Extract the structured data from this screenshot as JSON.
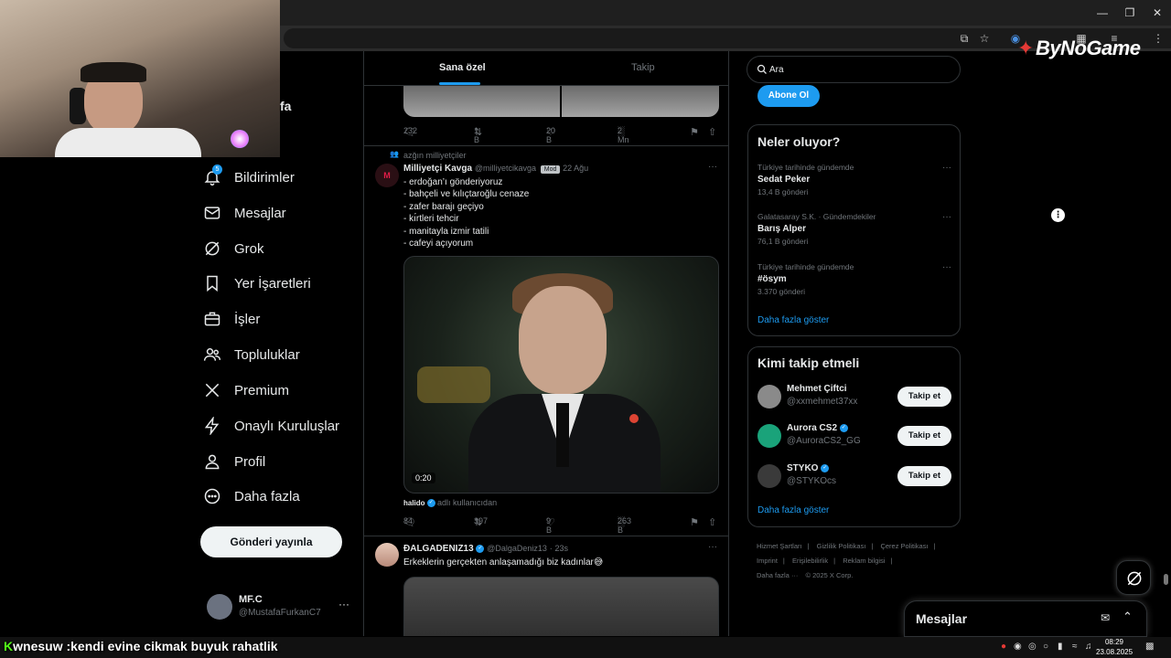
{
  "overlay": {
    "brand": "ByNoGame",
    "brand_mark": "✦",
    "ticker_prefix": "K",
    "ticker_text": "wnesuw :kendi evine cikmak buyuk rahatlik",
    "clock_time": "08:29",
    "clock_date": "23.08.2025"
  },
  "sidebar": {
    "name_fragment": "fa",
    "items": [
      {
        "label": "Bildirimler",
        "icon": "bell-icon"
      },
      {
        "label": "Mesajlar",
        "icon": "mail-icon"
      },
      {
        "label": "Grok",
        "icon": "grok-icon"
      },
      {
        "label": "Yer İşaretleri",
        "icon": "bookmark-icon"
      },
      {
        "label": "İşler",
        "icon": "briefcase-icon"
      },
      {
        "label": "Topluluklar",
        "icon": "people-icon"
      },
      {
        "label": "Premium",
        "icon": "x-logo-icon"
      },
      {
        "label": "Onaylı Kuruluşlar",
        "icon": "lightning-icon"
      },
      {
        "label": "Profil",
        "icon": "person-icon"
      },
      {
        "label": "Daha fazla",
        "icon": "more-circle-icon"
      }
    ],
    "notification_badge": "5",
    "post_button": "Gönderi yayınla",
    "account": {
      "name": "MF.C",
      "handle": "@MustafaFurkanC7",
      "more": "···"
    }
  },
  "feed": {
    "tabs": [
      "Sana özel",
      "Takip"
    ],
    "tweet0": {
      "replies": "232",
      "retweets": "1 B",
      "likes": "20 B",
      "views": "2 Mn"
    },
    "tweet1": {
      "community": "azğın milliyetçiler",
      "name": "Milliyetçi Kavga",
      "handle": "@milliyetcikavga",
      "badge": "Mod",
      "date": "22 Ağu",
      "lines": [
        "- erdoğan’ı gönderiyoruz",
        "- bahçeli ve kılıçtaroğlu cenaze",
        "- zafer barajı geçiyo",
        "- kı́rtleri tehcir",
        "- manitayla izmir tatili",
        "- cafeyi açıyorum"
      ],
      "video_time": "0:20",
      "attribution_name": "halido",
      "attribution_text": "adlı kullanıcıdan",
      "replies": "84",
      "retweets": "397",
      "likes": "9 B",
      "views": "263 B"
    },
    "tweet2": {
      "name": "ĐALGADENIZ13",
      "handle": "@DalgaDeniz13",
      "date": "23s",
      "text": "Erkeklerin gerçekten anlaşamadığı biz kadınlar😅"
    }
  },
  "right": {
    "search_placeholder": "Ara",
    "subscribe_button": "Abone Ol",
    "trends_title": "Neler oluyor?",
    "trends": [
      {
        "context": "Türkiye tarihinde gündemde",
        "title": "Sedat Peker",
        "count": "13,4 B gönderi"
      },
      {
        "context": "Galatasaray S.K. · Gündemdekiler",
        "title": "Barış Alper",
        "count": "76,1 B gönderi"
      },
      {
        "context": "Türkiye tarihinde gündemde",
        "title": "#ösym",
        "count": "3.370 gönderi"
      }
    ],
    "show_more": "Daha fazla göster",
    "follow_title": "Kimi takip etmeli",
    "follow": [
      {
        "name": "Mehmet Çiftci",
        "handle": "@xxmehmet37xx",
        "verified": false,
        "button": "Takip et",
        "avatar_color": "#8a8a8a"
      },
      {
        "name": "Aurora CS2",
        "handle": "@AuroraCS2_GG",
        "verified": true,
        "button": "Takip et",
        "avatar_color": "#1aa37a"
      },
      {
        "name": "STYKO",
        "handle": "@STYKOcs",
        "verified": true,
        "button": "Takip et",
        "avatar_color": "#3a3a3a"
      }
    ],
    "follow_show_more": "Daha fazla göster",
    "footer": [
      "Hizmet Şartları",
      "|",
      "Gizlilik Politikası",
      "|",
      "Çerez Politikası",
      "|",
      "Imprint",
      "|",
      "Erişilebilirlik",
      "|",
      "Reklam bilgisi",
      "|",
      "Daha fazla ···",
      "© 2025 X Corp."
    ]
  },
  "dm": {
    "title": "Mesajlar"
  },
  "colors": {
    "accent": "#1d9bf0",
    "background": "#000000",
    "border": "#2f3336",
    "muted": "#71767b"
  }
}
